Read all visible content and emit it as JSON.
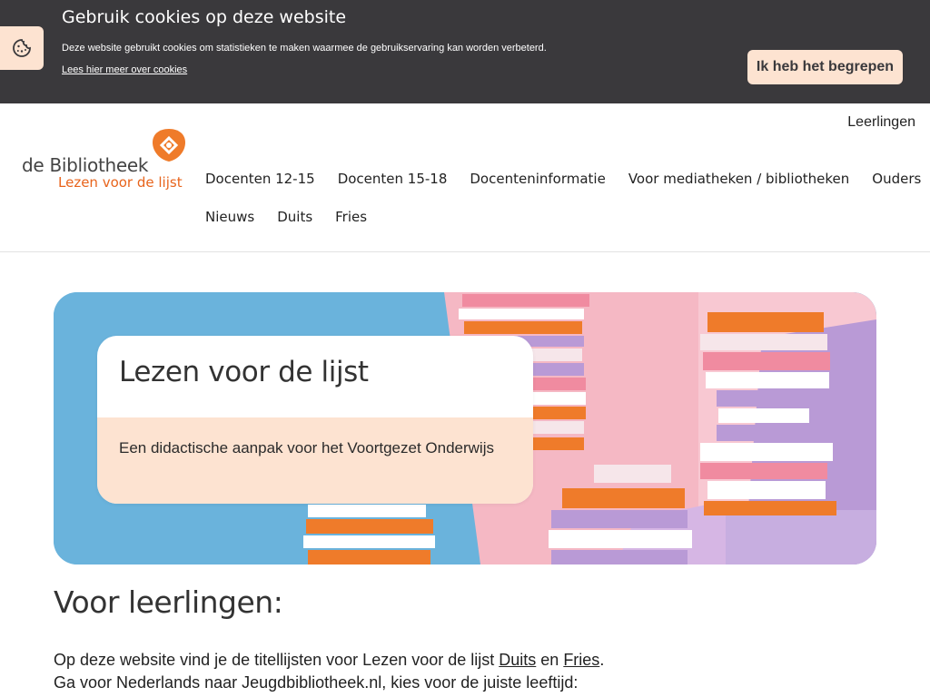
{
  "cookie_bar": {
    "title": "Gebruik cookies op deze website",
    "text": "Deze website gebruikt cookies om statistieken te maken waarmee de gebruikservaring kan worden verbeterd.",
    "link": "Lees hier meer over cookies",
    "accept_label": "Ik heb het begrepen",
    "icon": "cookie-icon"
  },
  "header": {
    "logo_main": "de Bibliotheek",
    "logo_sub": "Lezen voor de lijst",
    "top_link": "Leerlingen",
    "nav_row1": [
      "Docenten 12-15",
      "Docenten 15-18",
      "Docenteninformatie",
      "Voor mediatheken / bibliotheken",
      "Ouders"
    ],
    "nav_row2": [
      "Nieuws",
      "Duits",
      "Fries"
    ]
  },
  "hero": {
    "title": "Lezen voor de lijst",
    "subtitle": "Een didactische aanpak voor het Voortgezet Onderwijs"
  },
  "content": {
    "heading": "Voor leerlingen:",
    "line1_prefix": "Op deze website vind je de titellijsten voor Lezen voor de lijst ",
    "link_duits": "Duits",
    "line1_mid": " en ",
    "link_fries": "Fries",
    "line1_suffix": ".",
    "line2": "Ga voor Nederlands naar Jeugdbibliotheek.nl, kies voor de juiste leeftijd:"
  },
  "colors": {
    "cookie_bg": "#3a393c",
    "accent_peach": "#fde3d1",
    "brand_orange": "#e8641c",
    "hero_blue": "#6ab3dc"
  }
}
